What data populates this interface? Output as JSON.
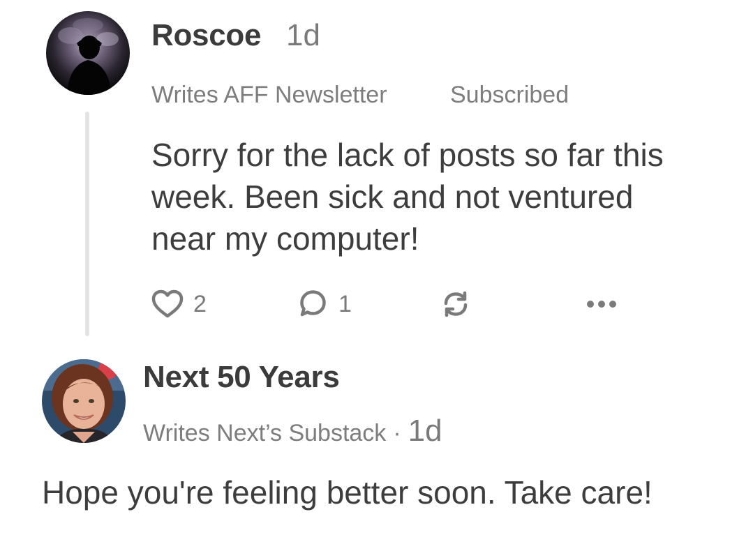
{
  "comments": [
    {
      "author": "Roscoe",
      "time": "1d",
      "writes": "Writes AFF Newsletter",
      "status": "Subscribed",
      "body": "Sorry for the lack of posts so far this week. Been sick and not ventured near my computer!",
      "actions": {
        "like_count": "2",
        "comment_count": "1",
        "like_icon": "heart-icon",
        "comment_icon": "speech-bubble-icon",
        "restack_icon": "restack-icon",
        "more_icon": "more-icon"
      }
    },
    {
      "author": "Next 50 Years",
      "writes": "Writes Next’s Substack",
      "separator": "·",
      "time": "1d",
      "body": "Hope you're feeling better soon. Take care!"
    }
  ],
  "colors": {
    "text": "#3d3d3d",
    "muted": "#7d7d7d",
    "thread_line": "#e4e4e4"
  }
}
